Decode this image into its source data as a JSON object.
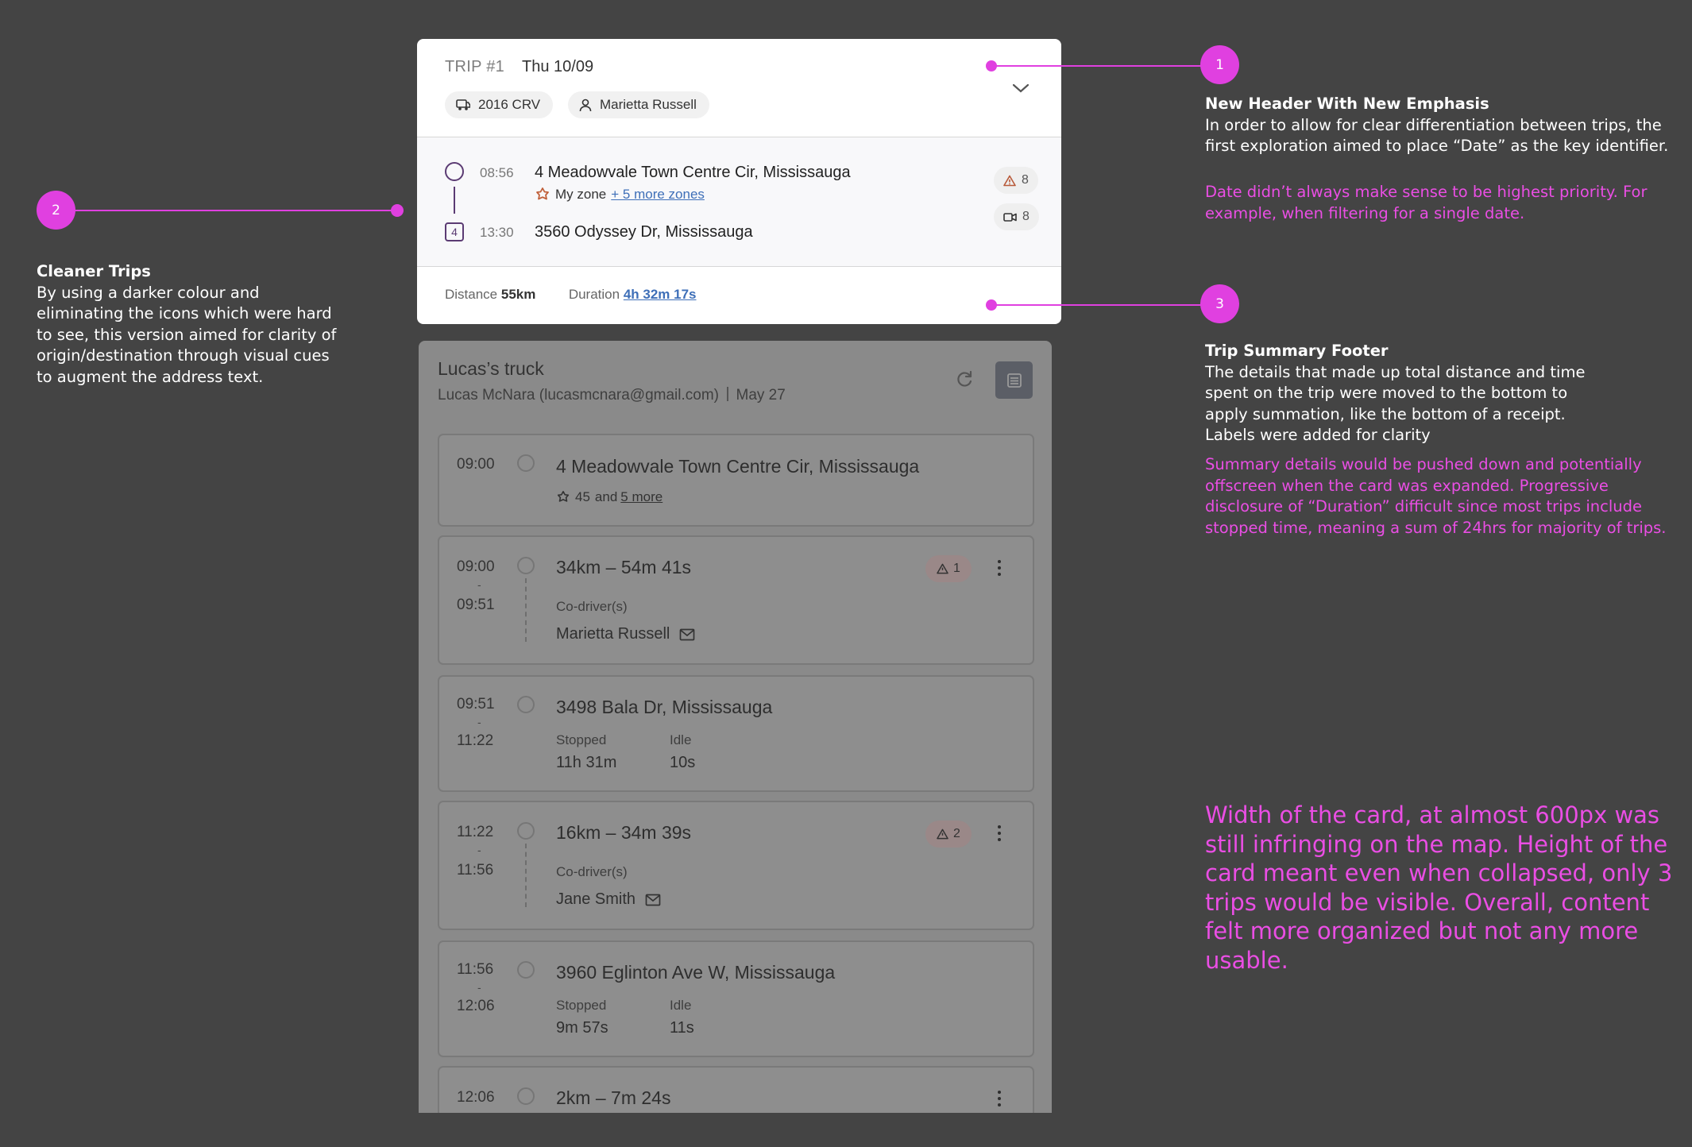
{
  "trip_card": {
    "trip_label": "TRIP #1",
    "date": "Thu 10/09",
    "vehicle": "2016 CRV",
    "driver": "Marietta Russell",
    "origin": {
      "time": "08:56",
      "address": "4 Meadowvale Town Centre Cir, Mississauga",
      "zone": "My zone",
      "more_zones": "+ 5 more zones"
    },
    "destination": {
      "stop_number": "4",
      "time": "13:30",
      "address": "3560 Odyssey Dr, Mississauga"
    },
    "alerts_count": "8",
    "videos_count": "8",
    "footer": {
      "distance_label": "Distance",
      "distance_value": "55km",
      "duration_label": "Duration",
      "duration_value": "4h 32m 17s"
    }
  },
  "old_card": {
    "title": "Lucas’s truck",
    "owner": "Lucas McNara (lucasmcnara@gmail.com)",
    "date": "May 27",
    "segments": [
      {
        "type": "stop",
        "time": "09:00",
        "address": "4 Meadowvale Town Centre Cir, Mississauga",
        "zones_count": "45",
        "and": "and",
        "more": "5 more"
      },
      {
        "type": "drive",
        "start": "09:00",
        "dash": "-",
        "end": "09:51",
        "summary": "34km – 54m 41s",
        "alerts": "1",
        "codriver_label": "Co-driver(s)",
        "codriver": "Marietta Russell"
      },
      {
        "type": "stop",
        "start": "09:51",
        "dash": "-",
        "end": "11:22",
        "address": "3498 Bala Dr, Mississauga",
        "stopped_label": "Stopped",
        "stopped": "11h 31m",
        "idle_label": "Idle",
        "idle": "10s"
      },
      {
        "type": "drive",
        "start": "11:22",
        "dash": "-",
        "end": "11:56",
        "summary": "16km – 34m 39s",
        "alerts": "2",
        "codriver_label": "Co-driver(s)",
        "codriver": "Jane Smith"
      },
      {
        "type": "stop",
        "start": "11:56",
        "dash": "-",
        "end": "12:06",
        "address": "3960 Eglinton Ave W, Mississauga",
        "stopped_label": "Stopped",
        "stopped": "9m 57s",
        "idle_label": "Idle",
        "idle": "11s"
      },
      {
        "type": "drive",
        "start": "12:06",
        "summary": "2km – 7m 24s"
      }
    ]
  },
  "annotations": {
    "one": {
      "badge": "1",
      "title": "New Header With New Emphasis",
      "body": "In order to allow for clear differentiation between trips, the first exploration aimed to place “Date” as the key identifier.",
      "critique": "Date didn’t always make sense to be highest priority. For example, when filtering for a single date."
    },
    "two": {
      "badge": "2",
      "title": "Cleaner Trips",
      "body": "By using a darker colour and eliminating the icons which were hard to see, this version aimed for clarity of origin/destination through visual cues to augment the address text."
    },
    "three": {
      "badge": "3",
      "title": "Trip Summary Footer",
      "body": "The details that made up total distance and time spent on the trip were moved to the bottom to apply summation, like the bottom of a receipt. Labels were added for clarity",
      "critique": "Summary details would be pushed down and potentially offscreen when the card was expanded. Progressive disclosure of “Duration” difficult since most trips include stopped time, meaning a sum of 24hrs for majority of trips."
    },
    "conclusion": "Width of the card, at almost 600px was still infringing on the map. Height of the card meant even when collapsed, only 3 trips would be visible. Overall, content felt more organized but not any more usable."
  },
  "colors": {
    "background": "#444444",
    "annotation": "#e040e0",
    "annotation_text": "#ea4ee4",
    "link": "#3e6fb8",
    "route": "#5b3b73"
  }
}
